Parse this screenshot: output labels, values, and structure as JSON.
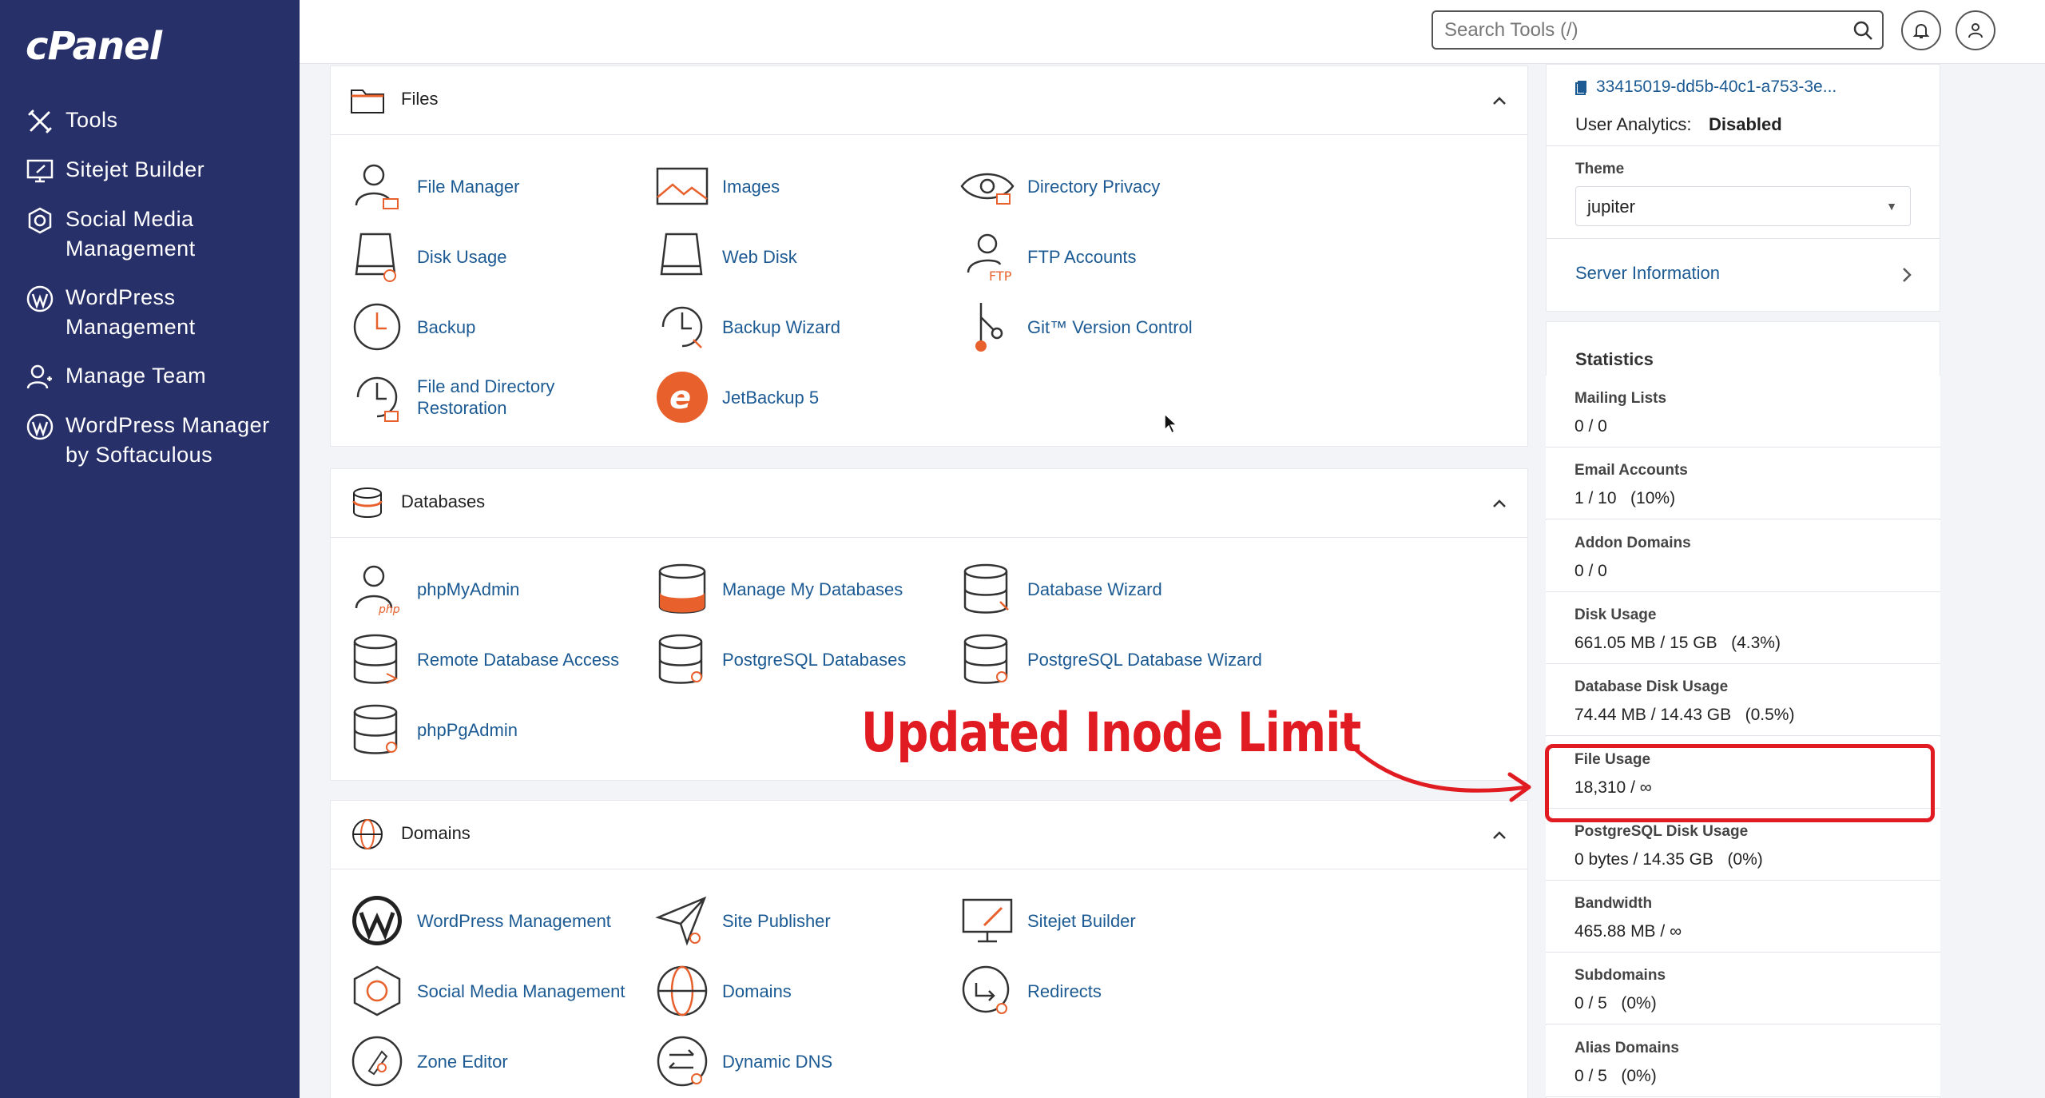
{
  "app": {
    "logo": "cPanel"
  },
  "sidebar": {
    "items": [
      {
        "label": "Tools",
        "icon": "tools-icon"
      },
      {
        "label": "Sitejet Builder",
        "icon": "sitejet-icon"
      },
      {
        "label": "Social Media Management",
        "icon": "social-media-icon"
      },
      {
        "label": "WordPress Management",
        "icon": "wordpress-icon"
      },
      {
        "label": "Manage Team",
        "icon": "manage-team-icon"
      },
      {
        "label": "WordPress Manager by Softaculous",
        "icon": "wordpress-icon"
      }
    ]
  },
  "topbar": {
    "search_placeholder": "Search Tools (/)"
  },
  "sections": {
    "files": {
      "title": "Files",
      "tools": [
        "File Manager",
        "Images",
        "Directory Privacy",
        "Disk Usage",
        "Web Disk",
        "FTP Accounts",
        "Backup",
        "Backup Wizard",
        "Git™ Version Control",
        "File and Directory Restoration",
        "JetBackup 5"
      ]
    },
    "databases": {
      "title": "Databases",
      "tools": [
        "phpMyAdmin",
        "Manage My Databases",
        "Database Wizard",
        "Remote Database Access",
        "PostgreSQL Databases",
        "PostgreSQL Database Wizard",
        "phpPgAdmin"
      ]
    },
    "domains": {
      "title": "Domains",
      "tools": [
        "WordPress Management",
        "Site Publisher",
        "Sitejet Builder",
        "Social Media Management",
        "Domains",
        "Redirects",
        "Zone Editor",
        "Dynamic DNS"
      ]
    }
  },
  "info": {
    "id_text": "33415019-dd5b-40c1-a753-3e...",
    "analytics_label": "User Analytics:",
    "analytics_value": "Disabled",
    "theme_label": "Theme",
    "theme_value": "jupiter",
    "server_info": "Server Information"
  },
  "statistics": {
    "title": "Statistics",
    "items": [
      {
        "label": "Mailing Lists",
        "value": "0 / 0"
      },
      {
        "label": "Email Accounts",
        "value": "1 / 10   (10%)"
      },
      {
        "label": "Addon Domains",
        "value": "0 / 0"
      },
      {
        "label": "Disk Usage",
        "value": "661.05 MB / 15 GB   (4.3%)"
      },
      {
        "label": "Database Disk Usage",
        "value": "74.44 MB / 14.43 GB   (0.5%)"
      },
      {
        "label": "File Usage",
        "value": "18,310 / ∞"
      },
      {
        "label": "PostgreSQL Disk Usage",
        "value": "0 bytes / 14.35 GB   (0%)"
      },
      {
        "label": "Bandwidth",
        "value": "465.88 MB / ∞"
      },
      {
        "label": "Subdomains",
        "value": "0 / 5   (0%)"
      },
      {
        "label": "Alias Domains",
        "value": "0 / 5   (0%)"
      }
    ]
  },
  "annotation": {
    "text": "Updated Inode Limit"
  },
  "colors": {
    "sidebar": "#283069",
    "link": "#1c5a93",
    "accent": "#e8602c",
    "annotation": "#e11b22"
  }
}
